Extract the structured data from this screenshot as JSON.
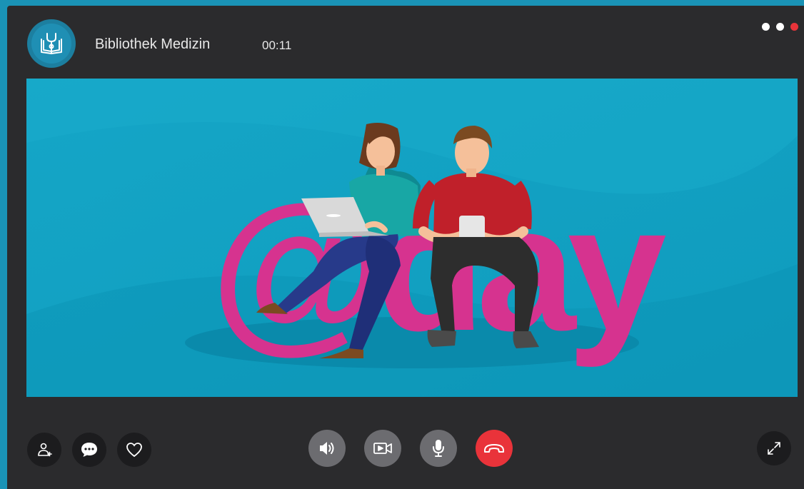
{
  "header": {
    "title": "Bibliothek Medizin",
    "timer": "00:11",
    "avatar_icon": "book-stethoscope-icon",
    "menu_icon": "three-dots-icon"
  },
  "video": {
    "logo_text": "@day"
  },
  "controls": {
    "left": [
      {
        "name": "add-user-button",
        "icon": "add-user-icon"
      },
      {
        "name": "chat-button",
        "icon": "chat-bubble-icon"
      },
      {
        "name": "favorite-button",
        "icon": "heart-icon"
      }
    ],
    "center": [
      {
        "name": "speaker-button",
        "icon": "speaker-icon"
      },
      {
        "name": "camera-button",
        "icon": "video-camera-icon"
      },
      {
        "name": "microphone-button",
        "icon": "microphone-icon"
      },
      {
        "name": "hang-up-button",
        "icon": "phone-hangup-icon"
      }
    ],
    "right": [
      {
        "name": "fullscreen-button",
        "icon": "expand-icon"
      }
    ]
  },
  "colors": {
    "page_background": "#1a93b6",
    "window_background": "#2b2b2d",
    "video_background": "#12a3c4",
    "logo_magenta": "#d6338f",
    "hang_up_red": "#e9333a",
    "menu_dot_red": "#e8343a"
  }
}
